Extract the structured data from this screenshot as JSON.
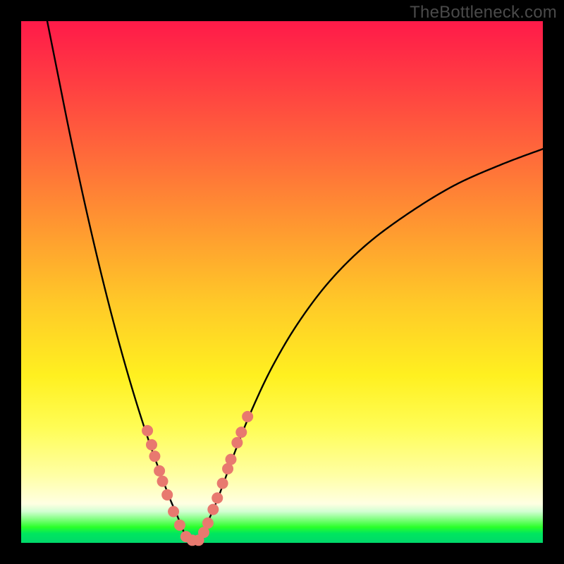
{
  "watermark": "TheBottleneck.com",
  "chart_data": {
    "type": "line",
    "title": "",
    "xlabel": "",
    "ylabel": "",
    "xlim": [
      0,
      100
    ],
    "ylim": [
      0,
      100
    ],
    "grid": false,
    "series": [
      {
        "name": "left-branch",
        "color": "#000000",
        "x": [
          5,
          7,
          9,
          11,
          13,
          15,
          17,
          19,
          21,
          23,
          25,
          27,
          28.5,
          30,
          31,
          31.8
        ],
        "y": [
          100,
          90,
          80,
          70.5,
          61.5,
          53,
          45,
          37.5,
          30.5,
          24,
          18,
          12.5,
          8.5,
          5,
          2.5,
          0.8
        ]
      },
      {
        "name": "right-branch",
        "color": "#000000",
        "x": [
          34.2,
          35,
          36,
          37.5,
          39,
          41,
          44,
          48,
          53,
          59,
          66,
          74,
          83,
          92,
          100
        ],
        "y": [
          0.8,
          2.2,
          4.5,
          8,
          12,
          17.5,
          25,
          33.5,
          42,
          50,
          57,
          63,
          68.5,
          72.5,
          75.5
        ]
      },
      {
        "name": "valley-floor",
        "color": "#000000",
        "x": [
          31.8,
          32.5,
          33.2,
          34.2
        ],
        "y": [
          0.8,
          0.4,
          0.4,
          0.8
        ]
      }
    ],
    "markers": {
      "name": "salmon-dots",
      "color": "#e8796f",
      "radius_px": 8,
      "points": [
        {
          "x": 24.2,
          "y": 21.5
        },
        {
          "x": 25.0,
          "y": 18.8
        },
        {
          "x": 25.6,
          "y": 16.6
        },
        {
          "x": 26.5,
          "y": 13.8
        },
        {
          "x": 27.1,
          "y": 11.8
        },
        {
          "x": 28.0,
          "y": 9.2
        },
        {
          "x": 29.2,
          "y": 6.0
        },
        {
          "x": 30.4,
          "y": 3.4
        },
        {
          "x": 31.6,
          "y": 1.2
        },
        {
          "x": 32.8,
          "y": 0.5
        },
        {
          "x": 34.0,
          "y": 0.5
        },
        {
          "x": 35.0,
          "y": 2.0
        },
        {
          "x": 35.8,
          "y": 3.8
        },
        {
          "x": 36.8,
          "y": 6.4
        },
        {
          "x": 37.6,
          "y": 8.6
        },
        {
          "x": 38.6,
          "y": 11.4
        },
        {
          "x": 39.6,
          "y": 14.2
        },
        {
          "x": 40.2,
          "y": 16.0
        },
        {
          "x": 41.4,
          "y": 19.2
        },
        {
          "x": 42.2,
          "y": 21.2
        },
        {
          "x": 43.4,
          "y": 24.2
        }
      ]
    }
  }
}
